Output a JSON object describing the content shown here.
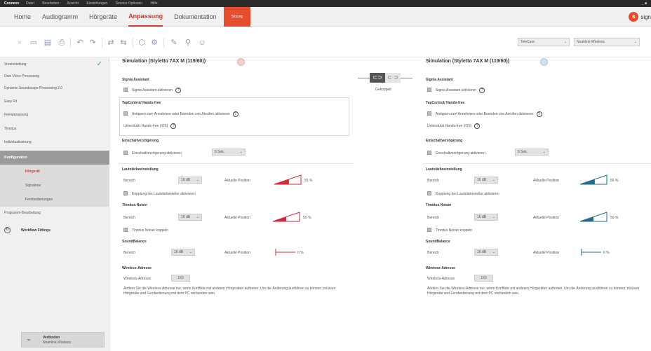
{
  "titlebar": {
    "app": "Connexx",
    "menu": [
      "Datei",
      "Bearbeiten",
      "Ansicht",
      "Einstellungen",
      "Service Optionen",
      "Hilfe"
    ],
    "window_controls": "_ ■"
  },
  "ribbon": {
    "tabs": [
      "Home",
      "Audiogramm",
      "Hörgeräte",
      "Anpassung",
      "Dokumentation"
    ],
    "active_tab": "Anpassung",
    "red_tab": "Sitzung",
    "logo_text": "sign",
    "logo_glyph": "s"
  },
  "toolbar": {
    "select1": "TeleCare",
    "select2": "Noahlink Wireless"
  },
  "sidebar": {
    "items": [
      "Voreinstellung",
      "Own Voice Processing",
      "Dynamic Soundscape Processing 2.0",
      "Easy Fit",
      "Feinanpassung",
      "Tinnitus",
      "Individualisierung"
    ],
    "section": "Konfiguration",
    "sub_items": [
      "Hörgerät",
      "Signalone",
      "Fernbedienungen"
    ],
    "bottom_item": "Programm-Bearbeitung",
    "workflow": "Workflow Fittings",
    "connect_title": "Verbinden",
    "connect_sub": "Noahlink Wireless"
  },
  "coupling": {
    "label": "Gekoppelt"
  },
  "left": {
    "title": "Simulation (Styletto 7AX M (119/60))",
    "signia_hd": "Signia Assistant",
    "signia_cb": "Signia Assistant aktivieren",
    "tap_hd": "TapControl/ Hands-free",
    "tap_cb": "Antippen zum Annehmen oder Beenden von Anrufen aktivieren",
    "tap_ios": "Unterstützt Hands-free (iOS)",
    "delay_hd": "Einschaltverzögerung",
    "delay_cb": "Einschaltverzögerung aktivieren",
    "delay_val": "6 Sek.",
    "vol_hd": "Lautstärkeeinstellung",
    "vol_range_lbl": "Bereich",
    "vol_range_val": "16 dB",
    "vol_pos_lbl": "Aktuelle Position",
    "vol_pct": "55 %",
    "vol_couple": "Kopplung der Lautstärkesteller aktivieren",
    "tin_hd": "Tinnitus Noiser",
    "tin_range_lbl": "Bereich",
    "tin_range_val": "16 dB",
    "tin_pos_lbl": "Aktuelle Position",
    "tin_pct": "50 %",
    "tin_couple": "Tinnitus Noiser koppeln",
    "sb_hd": "SoundBalance",
    "sb_range_lbl": "Bereich",
    "sb_range_val": "16 dB",
    "sb_pos_lbl": "Aktuelle Position",
    "sb_pct": "0 %",
    "wl_hd": "Wireless-Adresse",
    "wl_lbl": "Wireless-Adresse",
    "wl_val": "160",
    "note": "Ändern Sie die Wireless-Adresse nur, wenn Konflikte mit anderen Hörgeräten auftreten. Um die Änderung ausführen zu können, müssen Hörgeräte und Fernbedienung mit dem PC verbunden sein."
  },
  "right": {
    "title": "Simulation (Styletto 7AX M (119/60))",
    "signia_hd": "Signia Assistant",
    "signia_cb": "Signia Assistant aktivieren",
    "tap_hd": "TapControl/ Hands-free",
    "tap_cb": "Antippen zum Annehmen oder Beenden von Anrufen aktivieren",
    "tap_ios": "Unterstützt Hands-free (iOS)",
    "delay_hd": "Einschaltverzögerung",
    "delay_cb": "Einschaltverzögerung aktivieren",
    "delay_val": "6 Sek.",
    "vol_hd": "Lautstärkeeinstellung",
    "vol_range_lbl": "Bereich",
    "vol_range_val": "16 dB",
    "vol_pos_lbl": "Aktuelle Position",
    "vol_pct": "55 %",
    "vol_couple": "Kopplung der Lautstärkesteller aktivieren",
    "tin_hd": "Tinnitus Noiser",
    "tin_range_lbl": "Bereich",
    "tin_range_val": "16 dB",
    "tin_pos_lbl": "Aktuelle Position",
    "tin_pct": "50 %",
    "tin_couple": "Tinnitus Noiser koppeln",
    "sb_hd": "SoundBalance",
    "sb_range_lbl": "Bereich",
    "sb_range_val": "16 dB",
    "sb_pos_lbl": "Aktuelle Position",
    "sb_pct": "0 %",
    "wl_hd": "Wireless-Adresse",
    "wl_lbl": "Wireless-Adresse",
    "wl_val": "160",
    "note": "Ändern Sie die Wireless-Adresse nur, wenn Konflikte mit anderen Hörgeräten auftreten. Um die Änderung ausführen zu können, müssen Hörgeräte und Fernbedienung mit dem PC verbunden sein."
  },
  "levels": {
    "volume": 0.55,
    "tinnitus": 0.5,
    "soundbalance": 0.0
  },
  "colors": {
    "accent": "#d6372b",
    "left_side": "#d6273b",
    "right_side": "#1f6e8c",
    "check": "#3fa93f"
  },
  "icons": [
    "new-icon",
    "open-icon",
    "save-icon",
    "print-icon",
    "undo-icon",
    "redo-icon",
    "transfer-icon",
    "sync-icon",
    "connect-icon",
    "tools-icon",
    "edit-icon",
    "probe-icon",
    "person-icon"
  ]
}
